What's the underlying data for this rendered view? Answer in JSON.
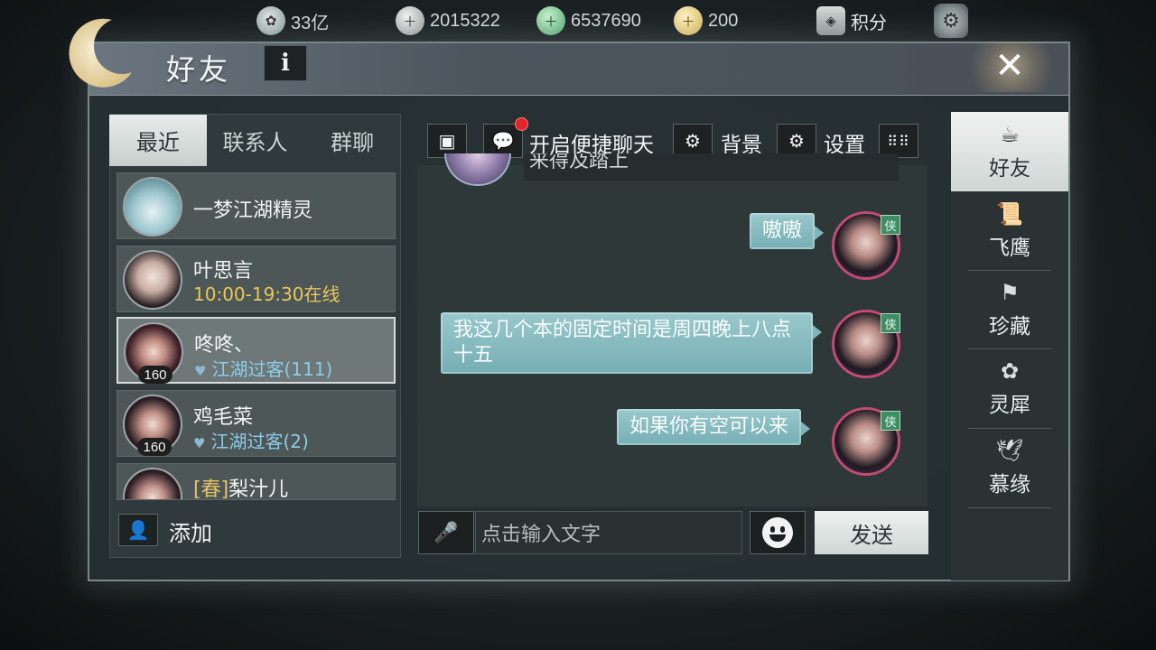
{
  "currencies": [
    {
      "icon": "coin-film-icon",
      "value": "33亿"
    },
    {
      "icon": "silver-ingot-icon",
      "value": "2015322"
    },
    {
      "icon": "jade-icon",
      "value": "6537690"
    },
    {
      "icon": "gold-ingot-icon",
      "value": "200"
    },
    {
      "icon": "shield-icon",
      "value": "积分"
    }
  ],
  "window": {
    "title": "好友",
    "info_label": "i",
    "close_label": "✕"
  },
  "left_tabs": [
    "最近",
    "联系人",
    "群聊"
  ],
  "friends": [
    {
      "name": "一梦江湖精灵",
      "sub": "",
      "level": ""
    },
    {
      "name": "叶思言",
      "sub": "10:00-19:30在线",
      "level": ""
    },
    {
      "name": "咚咚、",
      "sub": "江湖过客(111)",
      "level": "160"
    },
    {
      "name": "鸡毛菜",
      "sub": "江湖过客(2)",
      "level": "160"
    },
    {
      "name_tag": "[春]",
      "name": "梨汁儿",
      "sub": "",
      "level": ""
    }
  ],
  "add_label": "添加",
  "toolbar": {
    "quick_chat_label": "开启便捷聊天",
    "background_label": "背景",
    "settings_label": "设置"
  },
  "chat": {
    "cut_message": "来得及踏上",
    "messages": [
      {
        "text": "嗷嗷"
      },
      {
        "text": "我这几个本的固定时间是周四晚上八点十五"
      },
      {
        "text": "如果你有空可以来"
      }
    ],
    "badge": "侠"
  },
  "input": {
    "placeholder": "点击输入文字",
    "send_label": "发送"
  },
  "right_nav": [
    {
      "label": "好友",
      "icon": "teapot-icon"
    },
    {
      "label": "飞鹰",
      "icon": "scroll-icon"
    },
    {
      "label": "珍藏",
      "icon": "flag-icon"
    },
    {
      "label": "灵犀",
      "icon": "charm-icon"
    },
    {
      "label": "慕缘",
      "icon": "crane-icon"
    }
  ]
}
